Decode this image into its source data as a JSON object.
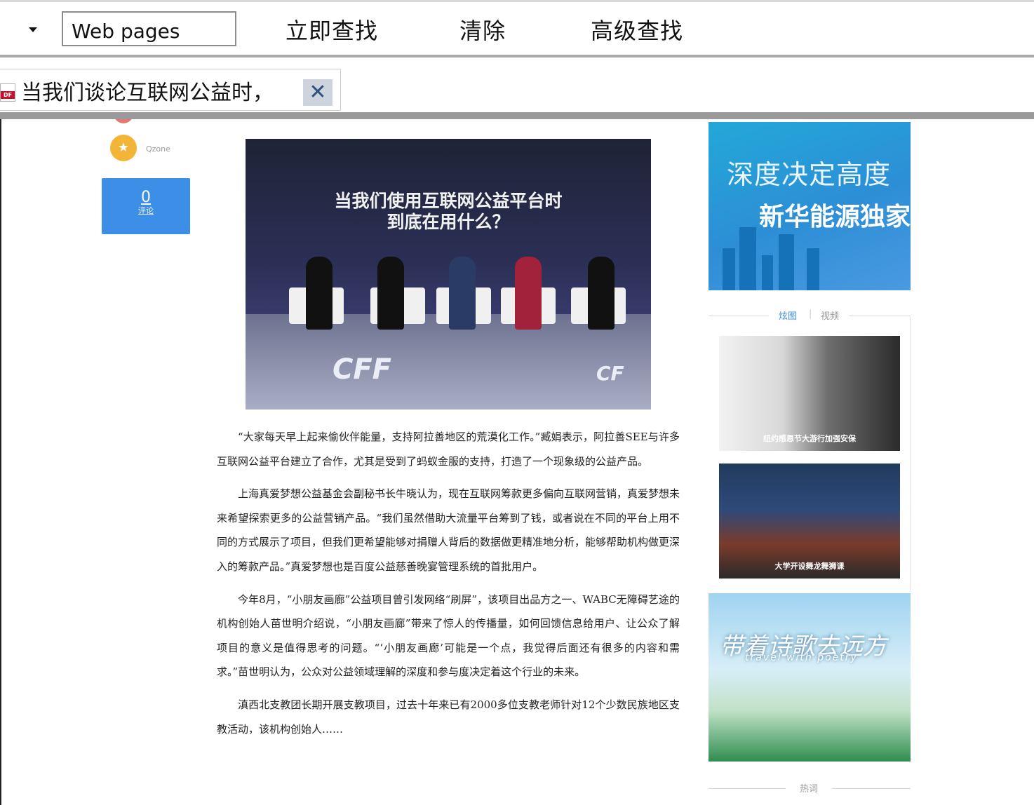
{
  "toolbar": {
    "search_value": "Web pages",
    "search_now_label": "立即查找",
    "clear_label": "清除",
    "advanced_search_label": "高级查找"
  },
  "tab": {
    "icon": "pdf-file-icon",
    "icon_text": "DF",
    "title": "当我们谈论互联网公益时，",
    "close_glyph": "✕"
  },
  "share": {
    "qzone_label": "Qzone",
    "comment_count": "0",
    "comment_label": "评论"
  },
  "article": {
    "image_caption_line1": "当我们使用互联网公益平台时",
    "image_caption_line2": "到底在用什么？",
    "paragraphs": [
      "“大家每天早上起来偷伙伴能量，支持阿拉善地区的荒漠化工作。”臧娟表示，阿拉善SEE与许多互联网公益平台建立了合作，尤其是受到了蚂蚁金服的支持，打造了一个现象级的公益产品。",
      "上海真爱梦想公益基金会副秘书长牛晓认为，现在互联网筹款更多偏向互联网营销，真爱梦想未来希望探索更多的公益营销产品。“我们虽然借助大流量平台筹到了钱，或者说在不同的平台上用不同的方式展示了项目，但我们更希望能够对捐赠人背后的数据做更精准地分析，能够帮助机构做更深入的筹款产品。”真爱梦想也是百度公益慈善晚宴管理系统的首批用户。",
      "今年8月，“小朋友画廊”公益项目曾引发网络“刷屏”，该项目出品方之一、WABC无障碍艺途的机构创始人苗世明介绍说，“小朋友画廊”带来了惊人的传播量，如何回馈信息给用户、让公众了解项目的意义是值得思考的问题。“‘小朋友画廊’可能是一个点，我觉得后面还有很多的内容和需求。”苗世明认为，公众对公益领域理解的深度和参与度决定着这个行业的未来。",
      "滇西北支教团长期开展支教项目，过去十年来已有2000多位支教老师针对12个少数民族地区支教活动，该机构创始人……"
    ]
  },
  "sidebar": {
    "banner_line1": "深度决定高度",
    "banner_line2": "新华能源独家",
    "media_tabs": [
      "炫图",
      "视频"
    ],
    "media_active": "炫图",
    "thumbs": [
      {
        "caption": "纽约感恩节大游行加强安保"
      },
      {
        "caption": "大学开设舞龙舞狮课"
      }
    ],
    "poster_title": "带着诗歌去远方",
    "poster_subtitle": "travel with poetry",
    "hot_label": "热词"
  },
  "colors": {
    "accent_blue": "#3d8ee6",
    "tab_active": "#3d8ee6",
    "tab_inactive": "#999999"
  }
}
